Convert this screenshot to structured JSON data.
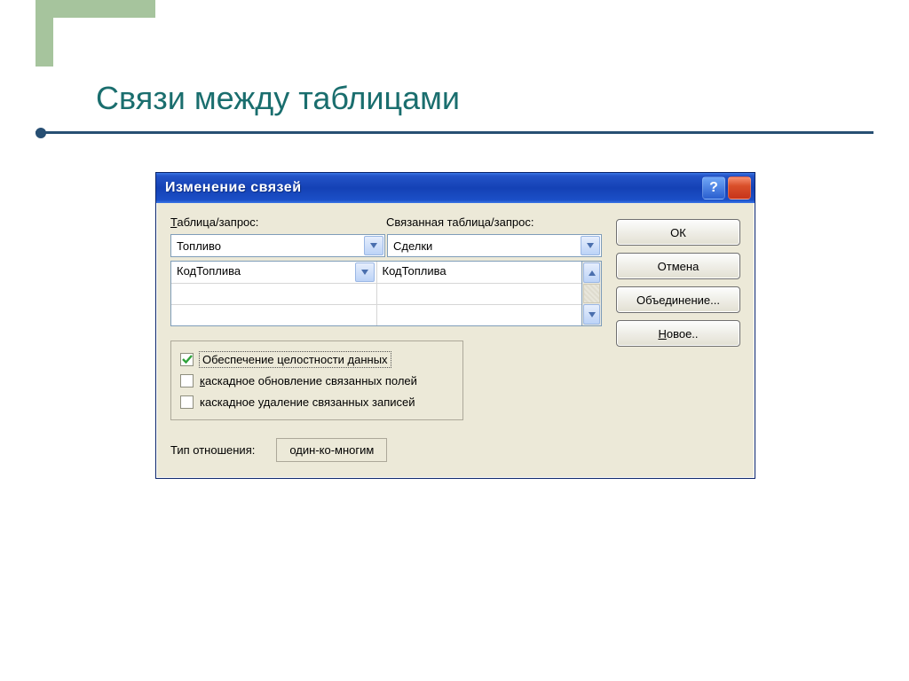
{
  "slide": {
    "title": "Связи между таблицами"
  },
  "dialog": {
    "title": "Изменение связей",
    "labels": {
      "tableQuery": "Таблица/запрос:",
      "tableQuery_u": "Т",
      "relatedTableQuery": "Связанная таблица/запрос:"
    },
    "leftCombo": "Топливо",
    "rightCombo": "Сделки",
    "gridRows": [
      {
        "left": "КодТоплива",
        "right": "КодТоплива"
      },
      {
        "left": "",
        "right": ""
      },
      {
        "left": "",
        "right": ""
      }
    ],
    "checks": {
      "integrity": {
        "label": "Обеспечение целостности данных",
        "checked": true
      },
      "cascadeUpdate": {
        "label": "каскадное обновление связанных полей",
        "checked": false,
        "underlineChar": "к"
      },
      "cascadeDelete": {
        "label": "каскадное удаление связанных записей",
        "checked": false
      }
    },
    "relType": {
      "label": "Тип отношения:",
      "value": "один-ко-многим"
    },
    "buttons": {
      "ok": "ОК",
      "cancel": "Отмена",
      "join": "Объединение...",
      "new": "Новое..",
      "new_u": "Н"
    }
  }
}
